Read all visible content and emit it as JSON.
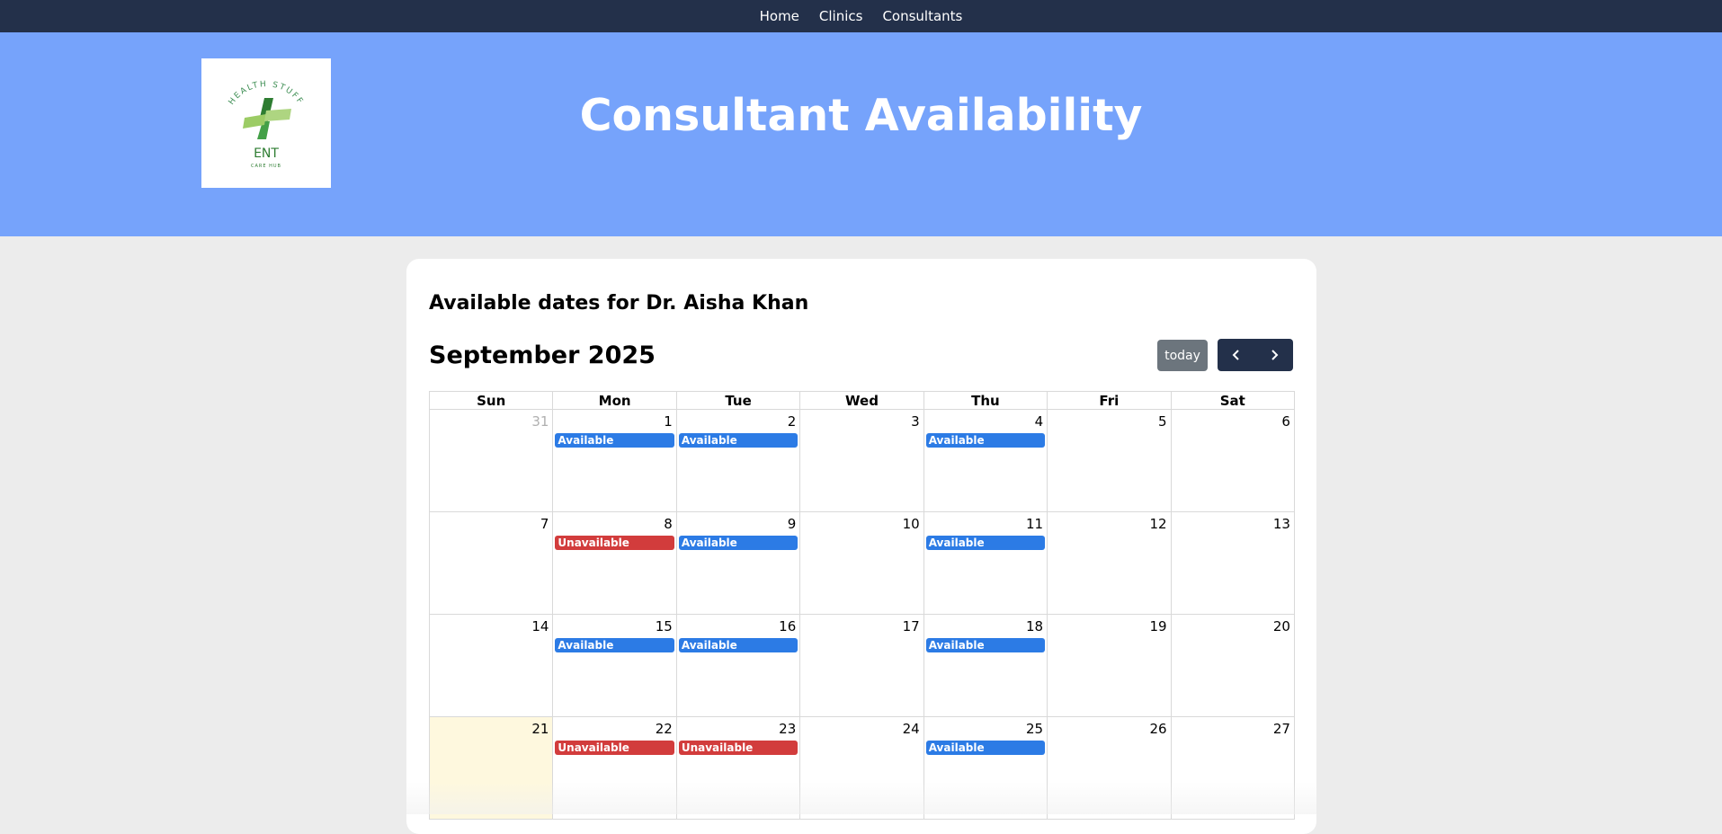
{
  "nav": {
    "items": [
      "Home",
      "Clinics",
      "Consultants"
    ]
  },
  "hero": {
    "title": "Consultant Availability",
    "logo": {
      "arc_text": "HEALTH STUFF",
      "brand": "ENT",
      "tagline": "CARE HUB"
    }
  },
  "card": {
    "heading": "Available dates for Dr. Aisha Khan"
  },
  "calendar": {
    "month_title": "September 2025",
    "today_label": "today",
    "prev_icon": "chevron-left-icon",
    "next_icon": "chevron-right-icon",
    "weekdays": [
      "Sun",
      "Mon",
      "Tue",
      "Wed",
      "Thu",
      "Fri",
      "Sat"
    ],
    "weeks": [
      [
        {
          "day": "31",
          "other_month": true
        },
        {
          "day": "1",
          "event": "Available"
        },
        {
          "day": "2",
          "event": "Available"
        },
        {
          "day": "3"
        },
        {
          "day": "4",
          "event": "Available"
        },
        {
          "day": "5"
        },
        {
          "day": "6"
        }
      ],
      [
        {
          "day": "7"
        },
        {
          "day": "8",
          "event": "Unavailable"
        },
        {
          "day": "9",
          "event": "Available"
        },
        {
          "day": "10"
        },
        {
          "day": "11",
          "event": "Available"
        },
        {
          "day": "12"
        },
        {
          "day": "13"
        }
      ],
      [
        {
          "day": "14"
        },
        {
          "day": "15",
          "event": "Available"
        },
        {
          "day": "16",
          "event": "Available"
        },
        {
          "day": "17"
        },
        {
          "day": "18",
          "event": "Available"
        },
        {
          "day": "19"
        },
        {
          "day": "20"
        }
      ],
      [
        {
          "day": "21",
          "today": true
        },
        {
          "day": "22",
          "event": "Unavailable"
        },
        {
          "day": "23",
          "event": "Unavailable"
        },
        {
          "day": "24"
        },
        {
          "day": "25",
          "event": "Available"
        },
        {
          "day": "26"
        },
        {
          "day": "27"
        }
      ]
    ]
  },
  "colors": {
    "nav_bg": "#23304a",
    "hero_bg": "#76a3fb",
    "available": "#2c7be5",
    "unavailable": "#d23c3c",
    "today_highlight": "#fef8de",
    "today_button": "#6c757d"
  }
}
